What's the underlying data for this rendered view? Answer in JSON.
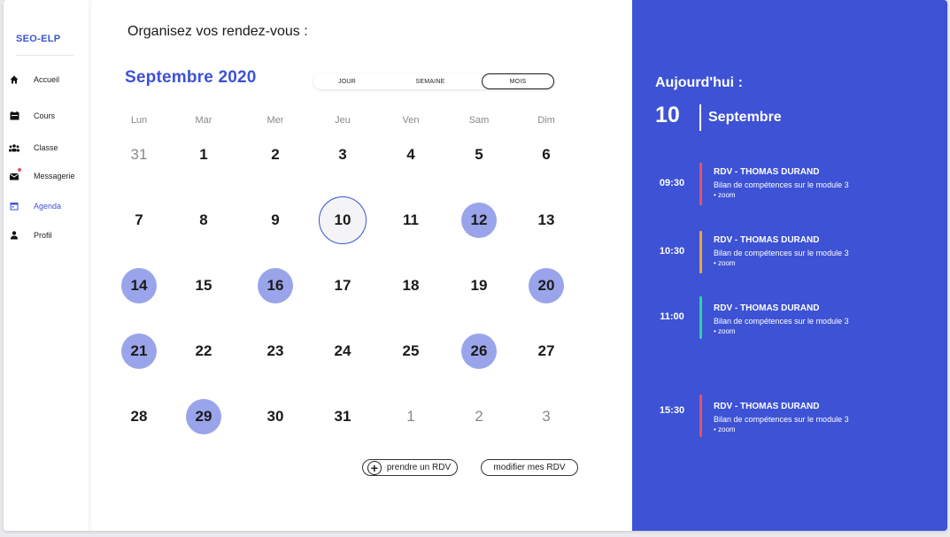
{
  "sidebar": {
    "brand": "SEO-ELP",
    "items": [
      {
        "label": "Accueil",
        "icon": "home-icon"
      },
      {
        "label": "Cours",
        "icon": "book-icon"
      },
      {
        "label": "Classe",
        "icon": "group-icon"
      },
      {
        "label": "Messagerie",
        "icon": "mail-icon"
      },
      {
        "label": "Agenda",
        "icon": "calendar-icon",
        "active": true
      },
      {
        "label": "Profil",
        "icon": "user-icon"
      }
    ]
  },
  "main": {
    "title": "Organisez vos rendez-vous :",
    "month": "Septembre 2020",
    "views": [
      "JOUR",
      "SEMAINE",
      "MOIS"
    ],
    "selected_view": "MOIS",
    "weekdays": [
      "Lun",
      "Mar",
      "Mer",
      "Jeu",
      "Ven",
      "Sam",
      "Dim"
    ],
    "weeks": [
      [
        "31",
        "1",
        "2",
        "3",
        "4",
        "5",
        "6"
      ],
      [
        "7",
        "8",
        "9",
        "10",
        "11",
        "12",
        "13"
      ],
      [
        "14",
        "15",
        "16",
        "17",
        "18",
        "19",
        "20"
      ],
      [
        "21",
        "22",
        "23",
        "24",
        "25",
        "26",
        "27"
      ],
      [
        "28",
        "29",
        "30",
        "31",
        "1",
        "2",
        "3"
      ]
    ],
    "actions": {
      "add": "prendre un RDV",
      "modify": "modifier mes RDV"
    }
  },
  "today_panel": {
    "label": "Aujourd'hui :",
    "day": "10",
    "month": "Septembre",
    "appointments": [
      {
        "time": "09:30",
        "title": "RDV - THOMAS DURAND",
        "description": "Bilan de compétences sur le module 3",
        "location": "• zoom",
        "color": "#e8506a"
      },
      {
        "time": "10:30",
        "title": "RDV - THOMAS DURAND",
        "description": "Bilan de compétences sur le module 3",
        "location": "• zoom",
        "color": "#f0a33a"
      },
      {
        "time": "11:00",
        "title": "RDV - THOMAS DURAND",
        "description": "Bilan de compétences sur le module 3",
        "location": "• zoom",
        "color": "#2bd3a3"
      },
      {
        "time": "15:30",
        "title": "RDV - THOMAS DURAND",
        "description": "Bilan de compétences sur le module 3",
        "location": "• zoom",
        "color": "#e8506a"
      }
    ]
  },
  "colors": {
    "accent": "#3d52d5",
    "highlight": "#9aa4ea"
  }
}
